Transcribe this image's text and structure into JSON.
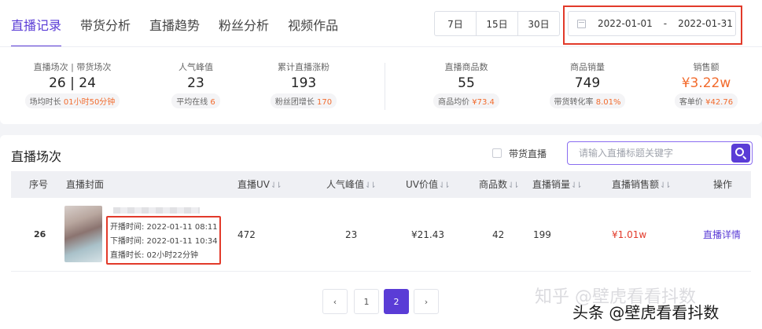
{
  "tabs": [
    {
      "label": "直播记录",
      "active": true
    },
    {
      "label": "带货分析",
      "active": false
    },
    {
      "label": "直播趋势",
      "active": false
    },
    {
      "label": "粉丝分析",
      "active": false
    },
    {
      "label": "视频作品",
      "active": false
    }
  ],
  "range_buttons": [
    "7日",
    "15日",
    "30日"
  ],
  "date_range": {
    "start": "2022-01-01",
    "separator": "-",
    "end": "2022-01-31",
    "icon": "calendar-icon"
  },
  "stats": [
    {
      "label": "直播场次 | 带货场次",
      "value": "26 | 24",
      "sub_label": "场均时长",
      "sub_value": "01小时50分钟"
    },
    {
      "label": "人气峰值",
      "value": "23",
      "sub_label": "平均在线",
      "sub_value": "6"
    },
    {
      "label": "累计直播涨粉",
      "value": "193",
      "sub_label": "粉丝团增长",
      "sub_value": "170"
    },
    {
      "label": "直播商品数",
      "value": "55",
      "sub_label": "商品均价",
      "sub_value": "¥73.4"
    },
    {
      "label": "商品销量",
      "value": "749",
      "sub_label": "带货转化率",
      "sub_value": "8.01%"
    },
    {
      "label": "销售额",
      "value": "¥3.22w",
      "sub_label": "客单价",
      "sub_value": "¥42.76"
    }
  ],
  "accent_color": "#5a3cd6",
  "highlight_color": "#f26b2d",
  "section": {
    "title": "直播场次",
    "checkbox_label": "带货直播",
    "search_placeholder": "请输入直播标题关键字",
    "search_icon": "search-icon"
  },
  "table": {
    "columns": [
      "序号",
      "直播封面",
      "直播UV",
      "人气峰值",
      "UV价值",
      "商品数",
      "直播销量",
      "直播销售额",
      "操作"
    ],
    "sort_icon": "⇃⇂",
    "rows": [
      {
        "index": "26",
        "start_time": "开播时间: 2022-01-11 08:11",
        "end_time": "下播时间: 2022-01-11 10:34",
        "duration": "直播时长: 02小时22分钟",
        "uv": "472",
        "peak": "23",
        "uv_value": "¥21.43",
        "products": "42",
        "sales": "199",
        "revenue": "¥1.01w",
        "action": "直播详情"
      }
    ]
  },
  "pagination": {
    "prev": "‹",
    "pages": [
      "1",
      "2"
    ],
    "current": "2",
    "next": "›"
  },
  "watermark": {
    "line1": "知乎 @壁虎看看抖数",
    "line2": "头条 @壁虎看看抖数"
  }
}
